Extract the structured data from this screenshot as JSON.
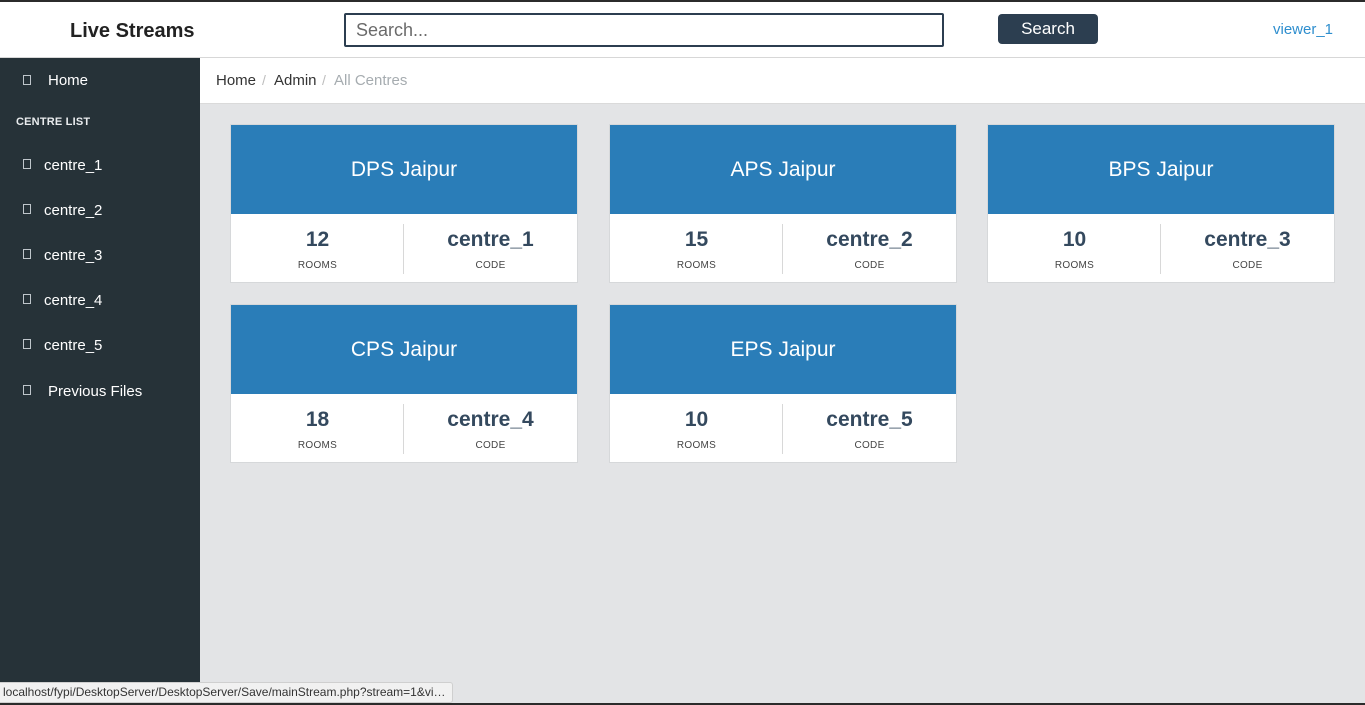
{
  "header": {
    "brand": "Live Streams",
    "search_placeholder": "Search...",
    "search_value": "",
    "search_button": "Search",
    "user": "viewer_1"
  },
  "sidebar": {
    "home": "Home",
    "section_heading": "CENTRE LIST",
    "centres": [
      "centre_1",
      "centre_2",
      "centre_3",
      "centre_4",
      "centre_5"
    ],
    "previous_files": "Previous Files"
  },
  "breadcrumb": {
    "items": [
      "Home",
      "Admin",
      "All Centres"
    ],
    "separator": "/"
  },
  "cards": [
    {
      "title": "DPS Jaipur",
      "rooms": "12",
      "rooms_label": "ROOMS",
      "code": "centre_1",
      "code_label": "CODE"
    },
    {
      "title": "APS Jaipur",
      "rooms": "15",
      "rooms_label": "ROOMS",
      "code": "centre_2",
      "code_label": "CODE"
    },
    {
      "title": "BPS Jaipur",
      "rooms": "10",
      "rooms_label": "ROOMS",
      "code": "centre_3",
      "code_label": "CODE"
    },
    {
      "title": "CPS Jaipur",
      "rooms": "18",
      "rooms_label": "ROOMS",
      "code": "centre_4",
      "code_label": "CODE"
    },
    {
      "title": "EPS Jaipur",
      "rooms": "10",
      "rooms_label": "ROOMS",
      "code": "centre_5",
      "code_label": "CODE"
    }
  ],
  "status_bar": {
    "url": "localhost/fypi/DesktopServer/DesktopServer/Save/mainStream.php?stream=1&vie..."
  },
  "colors": {
    "card_header": "#2a7db8",
    "sidebar_bg": "#263238",
    "accent_dark": "#2c3e50",
    "link": "#2e8ece",
    "content_bg": "#e3e4e6"
  }
}
